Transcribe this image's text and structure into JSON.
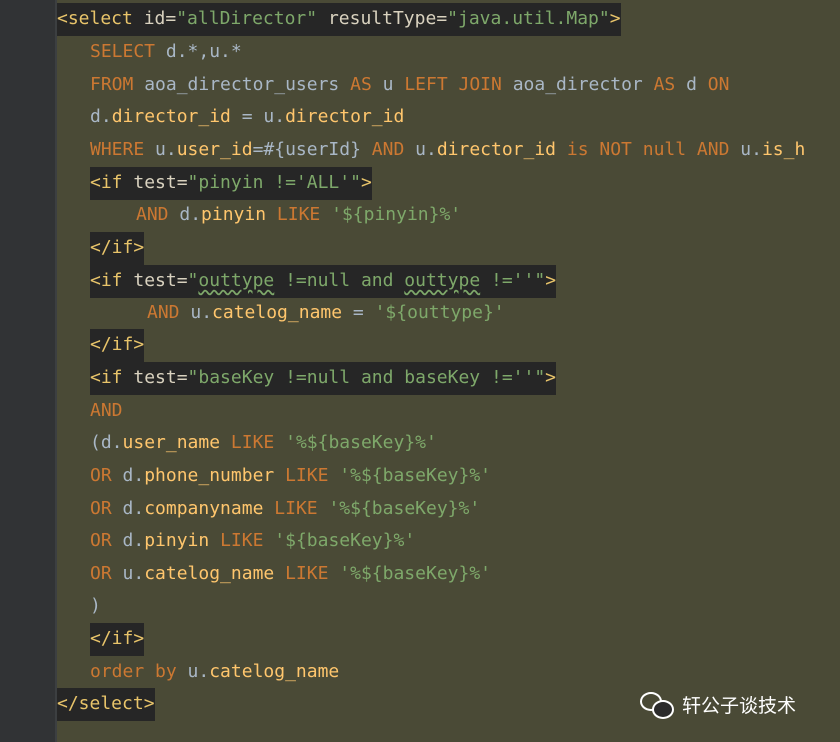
{
  "code": {
    "l1": {
      "p1": "<select",
      "p2": " id",
      "p3": "=",
      "p4": "\"allDirector\"",
      "p5": " resultType",
      "p6": "=",
      "p7": "\"java.util.Map\"",
      "p8": ">"
    },
    "l2": {
      "p1": "SELECT",
      "p2": " d.*,u.*"
    },
    "l3": {
      "p1": "FROM",
      "p2": " aoa_director_users ",
      "p3": "AS",
      "p4": " u ",
      "p5": "LEFT JOIN",
      "p6": " aoa_director ",
      "p7": "AS",
      "p8": " d ",
      "p9": "ON"
    },
    "l4": {
      "p1": "d.",
      "p2": "director_id",
      "p3": " = u.",
      "p4": "director_id"
    },
    "l5": {
      "p1": "WHERE",
      "p2": " u.",
      "p3": "user_id",
      "p4": "=#{userId} ",
      "p5": "AND",
      "p6": " u.",
      "p7": "director_id",
      "p8": " ",
      "p9": "is NOT null AND",
      "p10": " u.",
      "p11": "is_h"
    },
    "l6": {
      "p1": "<if",
      "p2": " test",
      "p3": "=",
      "p4": "\"pinyin !='ALL'\"",
      "p5": ">"
    },
    "l7": {
      "p1": "AND",
      "p2": " d.",
      "p3": "pinyin",
      "p4": " ",
      "p5": "LIKE",
      "p6": " '${pinyin}%'"
    },
    "l8": {
      "p1": "</if>"
    },
    "l9": {
      "p1": "<if",
      "p2": " test",
      "p3": "=",
      "p4": "\"",
      "p5": "outtype",
      "p6": " !=null and ",
      "p7": "outtype",
      "p8": " !=''\"",
      "p9": ">"
    },
    "l10": {
      "p1": "AND",
      "p2": " u.",
      "p3": "catelog_name",
      "p4": " = ",
      "p5": "'${outtype}'"
    },
    "l11": {
      "p1": "</if>"
    },
    "l12": {
      "p1": "<if",
      "p2": " test",
      "p3": "=",
      "p4": "\"baseKey !=null and baseKey !=''\"",
      "p5": ">"
    },
    "l13": {
      "p1": "AND"
    },
    "l14": {
      "p1": "(d.",
      "p2": "user_name",
      "p3": " ",
      "p4": "LIKE",
      "p5": " '%${baseKey}%'"
    },
    "l15": {
      "p1": "OR",
      "p2": " d.",
      "p3": "phone_number",
      "p4": " ",
      "p5": "LIKE",
      "p6": " '%${baseKey}%'"
    },
    "l16": {
      "p1": "OR",
      "p2": " d.",
      "p3": "companyname",
      "p4": " ",
      "p5": "LIKE",
      "p6": " '%${baseKey}%'"
    },
    "l17": {
      "p1": "OR",
      "p2": " d.",
      "p3": "pinyin",
      "p4": " ",
      "p5": "LIKE",
      "p6": " '${baseKey}%'"
    },
    "l18": {
      "p1": "OR",
      "p2": " u.",
      "p3": "catelog_name",
      "p4": " ",
      "p5": "LIKE",
      "p6": " '%${baseKey}%'"
    },
    "l19": {
      "p1": ")"
    },
    "l20": {
      "p1": "</if>"
    },
    "l21": {
      "p1": "order by",
      "p2": " u.",
      "p3": "catelog_name"
    },
    "l22": {
      "p1": "</select>"
    }
  },
  "watermark": {
    "text": "轩公子谈技术",
    "icon": "wechat-icon"
  }
}
